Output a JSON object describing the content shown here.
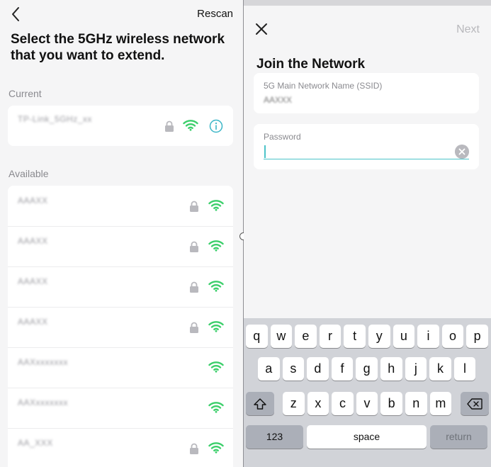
{
  "left": {
    "rescan_label": "Rescan",
    "heading": "Select the 5GHz wireless network that you want to extend.",
    "current_label": "Current",
    "available_label": "Available",
    "current_network": {
      "ssid": "TP-Link_5GHz_xx",
      "locked": true,
      "icon": "info-icon"
    },
    "networks": [
      {
        "ssid": "AAAXX",
        "locked": true
      },
      {
        "ssid": "AAAXX",
        "locked": true
      },
      {
        "ssid": "AAAXX",
        "locked": true
      },
      {
        "ssid": "AAAXX",
        "locked": true
      },
      {
        "ssid": "AAXxxxxxxx",
        "locked": false
      },
      {
        "ssid": "AAXxxxxxxx",
        "locked": false
      },
      {
        "ssid": "AA_XXX",
        "locked": true
      }
    ]
  },
  "right": {
    "next_label": "Next",
    "title": "Join the Network",
    "ssid_field": {
      "label": "5G Main Network Name (SSID)",
      "value": "AAXXX"
    },
    "password_field": {
      "label": "Password",
      "value": ""
    }
  },
  "keyboard": {
    "row1": [
      "q",
      "w",
      "e",
      "r",
      "t",
      "y",
      "u",
      "i",
      "o",
      "p"
    ],
    "row2": [
      "a",
      "s",
      "d",
      "f",
      "g",
      "h",
      "j",
      "k",
      "l"
    ],
    "row3": [
      "z",
      "x",
      "c",
      "v",
      "b",
      "n",
      "m"
    ],
    "numbers_label": "123",
    "space_label": "space",
    "return_label": "return"
  },
  "colors": {
    "accent": "#4cc3c9",
    "wifi_green": "#3ccf6b",
    "info_teal": "#3bb6c7",
    "lock_gray": "#b9b9be"
  }
}
